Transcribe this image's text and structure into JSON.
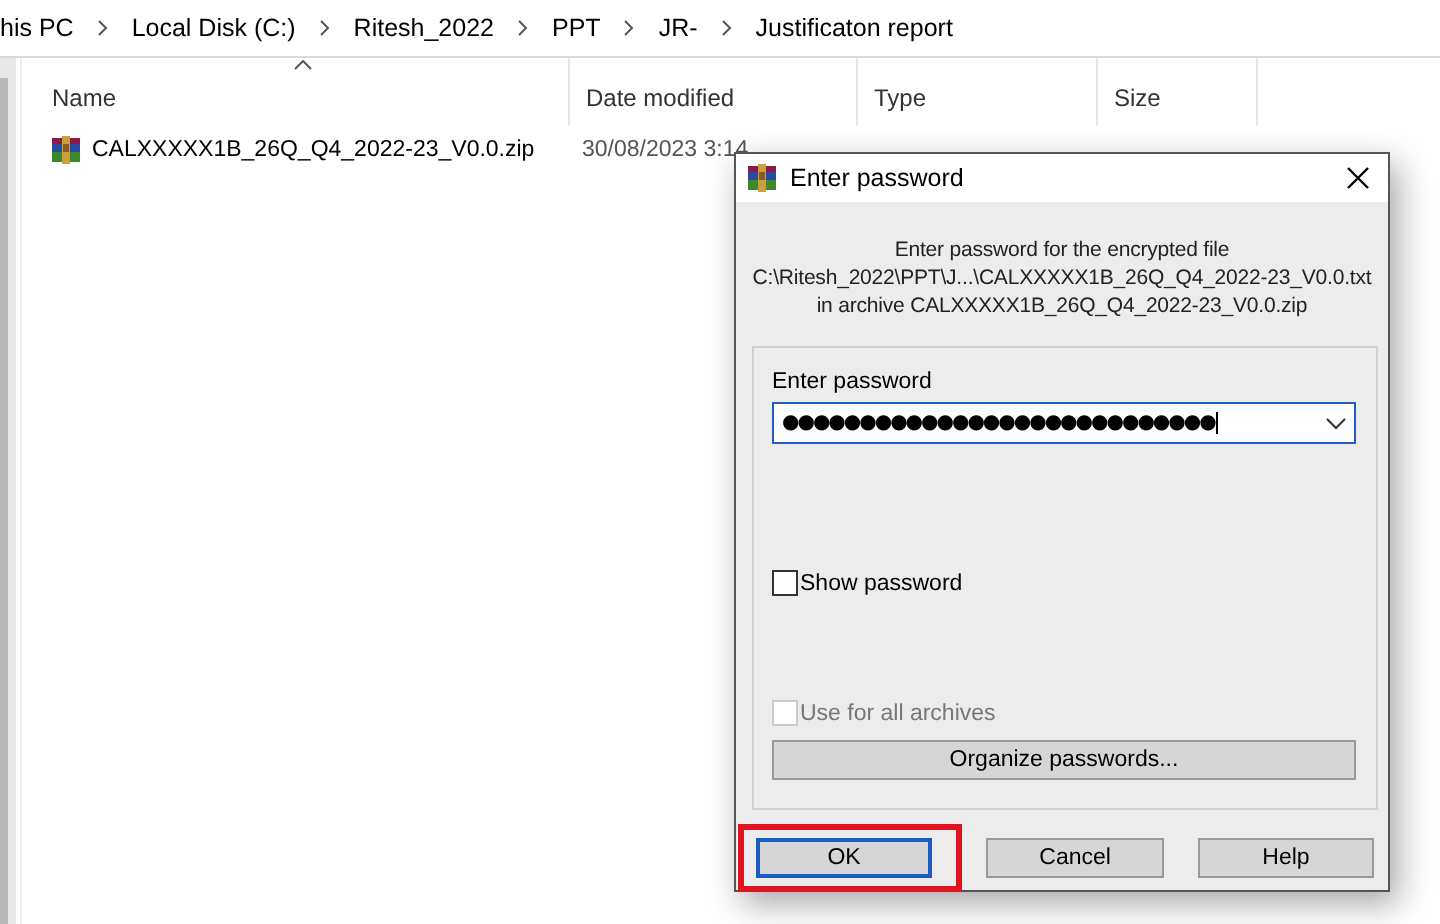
{
  "explorer": {
    "breadcrumb": [
      "his PC",
      "Local Disk (C:)",
      "Ritesh_2022",
      "PPT",
      "JR-",
      "Justificaton report"
    ],
    "columns": [
      {
        "label": "Name",
        "sorted": true
      },
      {
        "label": "Date modified",
        "sorted": false
      },
      {
        "label": "Type",
        "sorted": false
      },
      {
        "label": "Size",
        "sorted": false
      }
    ],
    "files": [
      {
        "name": "CALXXXXX1B_26Q_Q4_2022-23_V0.0.zip",
        "date": "30/08/2023 3:14"
      }
    ]
  },
  "dialog": {
    "title": "Enter password",
    "message": [
      "Enter password for the encrypted file",
      "C:\\Ritesh_2022\\PPT\\J...\\CALXXXXX1B_26Q_Q4_2022-23_V0.0.txt",
      "in archive CALXXXXX1B_26Q_Q4_2022-23_V0.0.zip"
    ],
    "password_label": "Enter password",
    "password_value": "●●●●●●●●●●●●●●●●●●●●●●●●●●●●",
    "options": [
      {
        "label": "Show password",
        "checked": false,
        "disabled": false
      },
      {
        "label": "Use for all archives",
        "checked": false,
        "disabled": true
      }
    ],
    "organize_button": "Organize passwords...",
    "buttons": [
      {
        "label": "OK",
        "focused": true,
        "highlighted": true
      },
      {
        "label": "Cancel",
        "focused": false,
        "highlighted": false
      },
      {
        "label": "Help",
        "focused": false,
        "highlighted": false
      }
    ]
  }
}
